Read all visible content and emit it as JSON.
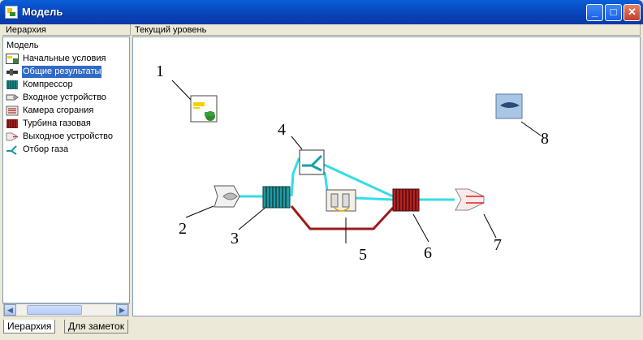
{
  "window": {
    "title": "Модель",
    "buttons": [
      "minimize",
      "maximize",
      "close"
    ]
  },
  "headers": {
    "left": "Иерархия",
    "right": "Текущий уровень"
  },
  "tree": {
    "root": "Модель",
    "items": [
      {
        "label": "Начальные условия",
        "icon": "initial-conditions-icon",
        "selected": false
      },
      {
        "label": "Общие результаты",
        "icon": "general-results-icon",
        "selected": true
      },
      {
        "label": "Компрессор",
        "icon": "compressor-icon",
        "selected": false
      },
      {
        "label": "Входное устройство",
        "icon": "inlet-device-icon",
        "selected": false
      },
      {
        "label": "Камера сгорания",
        "icon": "combustion-chamber-icon",
        "selected": false
      },
      {
        "label": "Турбина газовая",
        "icon": "gas-turbine-icon",
        "selected": false
      },
      {
        "label": "Выходное устройство",
        "icon": "nozzle-icon",
        "selected": false
      },
      {
        "label": "Отбор газа",
        "icon": "gas-bleed-icon",
        "selected": false
      }
    ]
  },
  "diagram": {
    "labels": [
      "1",
      "2",
      "3",
      "4",
      "5",
      "6",
      "7",
      "8"
    ],
    "colors": {
      "flow": "#33dde6",
      "shaft": "#9b1c1c"
    }
  },
  "tabs": [
    {
      "label": "Иерархия",
      "active": true
    },
    {
      "label": "Для заметок",
      "active": false
    }
  ]
}
